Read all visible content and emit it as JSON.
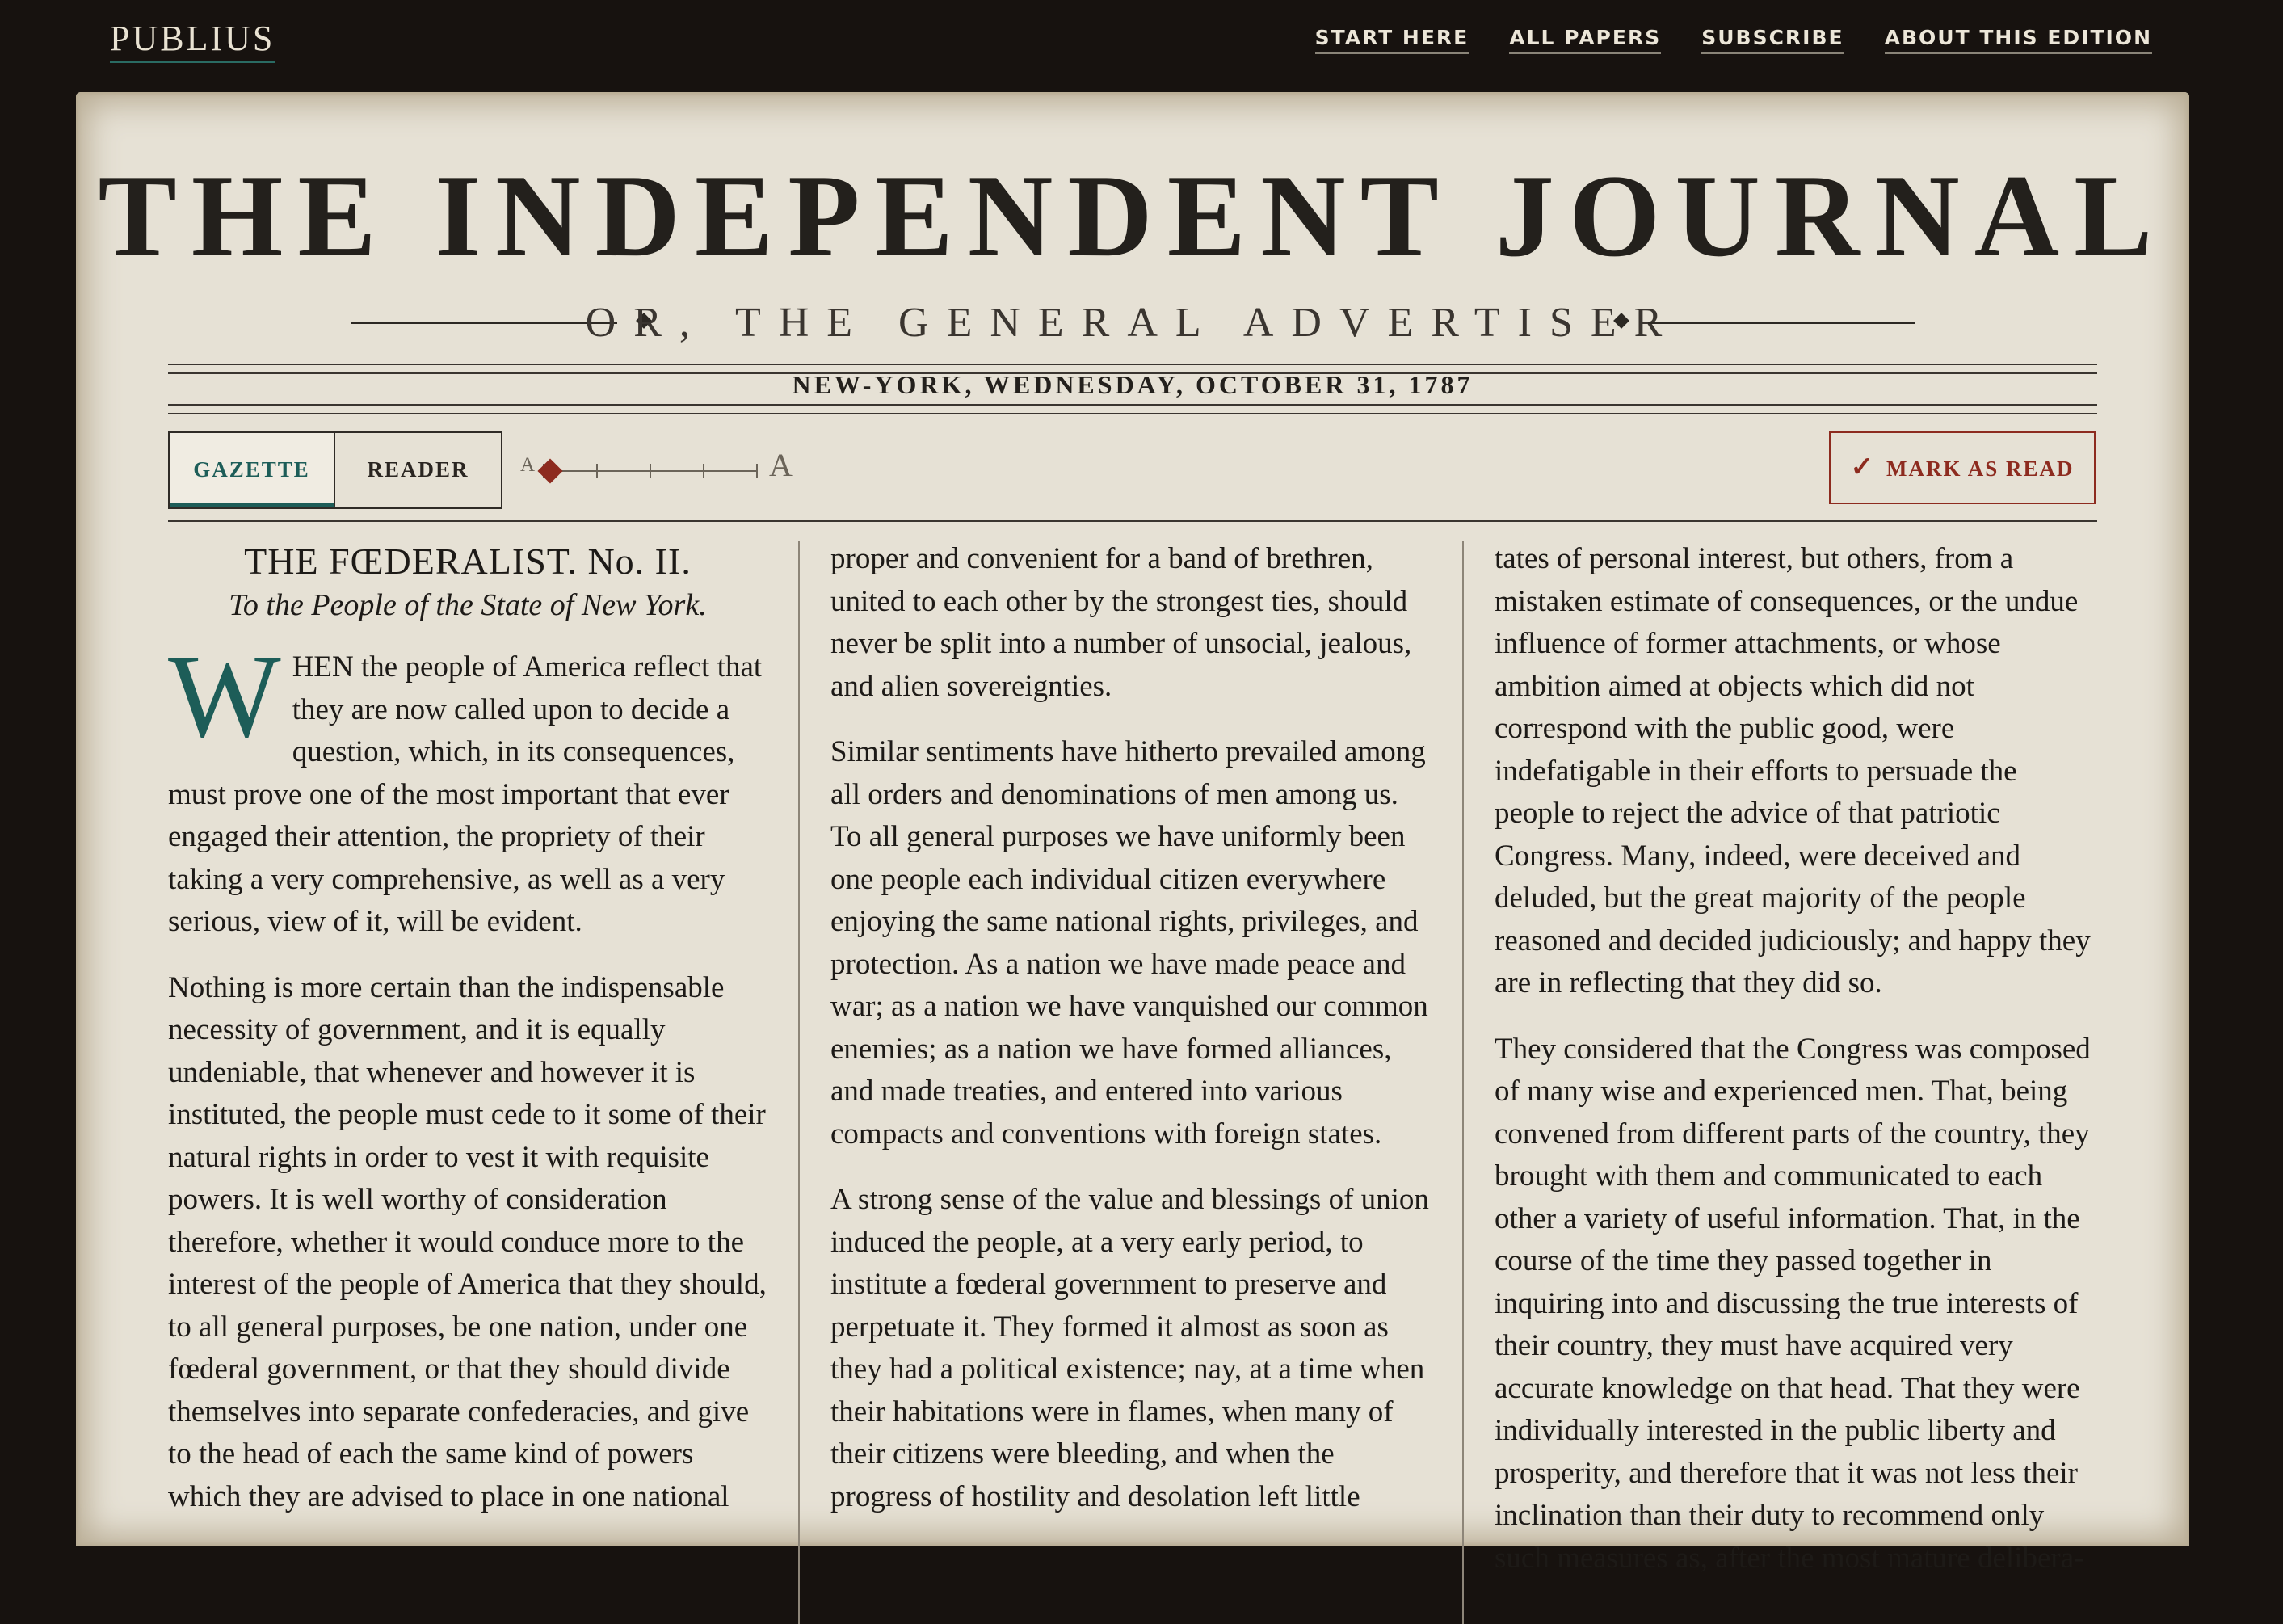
{
  "site": {
    "brand": "PUBLIUS",
    "nav": [
      "START HERE",
      "ALL PAPERS",
      "SUBSCRIBE",
      "ABOUT THIS EDITION"
    ]
  },
  "paper": {
    "masthead": "THE INDEPENDENT JOURNAL",
    "subtitle": "OR, THE GENERAL ADVERTISER",
    "dateline": "NEW-YORK, WEDNESDAY, OCTOBER 31, 1787"
  },
  "controls": {
    "modes": [
      "GAZETTE",
      "READER"
    ],
    "active_mode": "GAZETTE",
    "font_size_small": "A",
    "font_size_large": "A",
    "font_size_level": 0,
    "mark_read_label": "MARK AS READ",
    "mark_read_icon": "checkmark-icon"
  },
  "article": {
    "title": "THE FŒDERALIST. No. II.",
    "subtitle": "To the People of the State of New York.",
    "dropcap": "W",
    "col1": {
      "p1": "HEN the people of America reflect that they are now called upon to decide a question, which, in its consequences, must prove one of the most important that ever engaged their attention, the propriety of their taking a very comprehensive, as well as a very serious, view of it, will be evident.",
      "p2": "Nothing is more certain than the indispensable necessity of government, and it is equally undeniable, that whenever and however it is instituted, the people must cede to it some of their natural rights in order to vest it with requisite powers. It is well worthy of consideration therefore, whether it would conduce more to the interest of the people of America that they should, to all general purposes, be one nation, under one fœderal government, or that they should divide themselves into separate confederacies, and give to the head of each the same kind of powers which they are advised to place in one national"
    },
    "col2": {
      "p1": "proper and convenient for a band of brethren, united to each other by the strongest ties, should never be split into a number of unsocial, jealous, and alien sovereignties.",
      "p2": "Similar sentiments have hitherto prevailed among all orders and denominations of men among us. To all general purposes we have uniformly been one people each individual citizen everywhere enjoying the same national rights, privileges, and protection. As a nation we have made peace and war; as a nation we have vanquished our common enemies; as a nation we have formed alliances, and made treaties, and entered into various compacts and conventions with foreign states.",
      "p3": "A strong sense of the value and blessings of union induced the people, at a very early period, to institute a fœderal government to preserve and perpetuate it. They formed it almost as soon as they had a political existence; nay, at a time when their habitations were in flames, when many of their citizens were bleeding, and when the progress of hostility and desolation left little"
    },
    "col3": {
      "p1": "tates of personal interest, but others, from a mistaken estimate of consequences, or the undue influence of former attachments, or whose ambition aimed at objects which did not correspond with the public good, were indefatigable in their efforts to persuade the people to reject the advice of that patriotic Congress. Many, indeed, were deceived and deluded, but the great majority of the people reasoned and decided judiciously; and happy they are in reflecting that they did so.",
      "p2": "They considered that the Congress was composed of many wise and experienced men. That, being convened from different parts of the country, they brought with them and communicated to each other a variety of useful information. That, in the course of the time they passed together in inquiring into and discussing the true interests of their country, they must have acquired very accurate knowledge on that head. That they were individually interested in the public liberty and prosperity, and therefore that it was not less their inclination than their duty to recommend only such measures as, after the most mature delibera-"
    }
  }
}
